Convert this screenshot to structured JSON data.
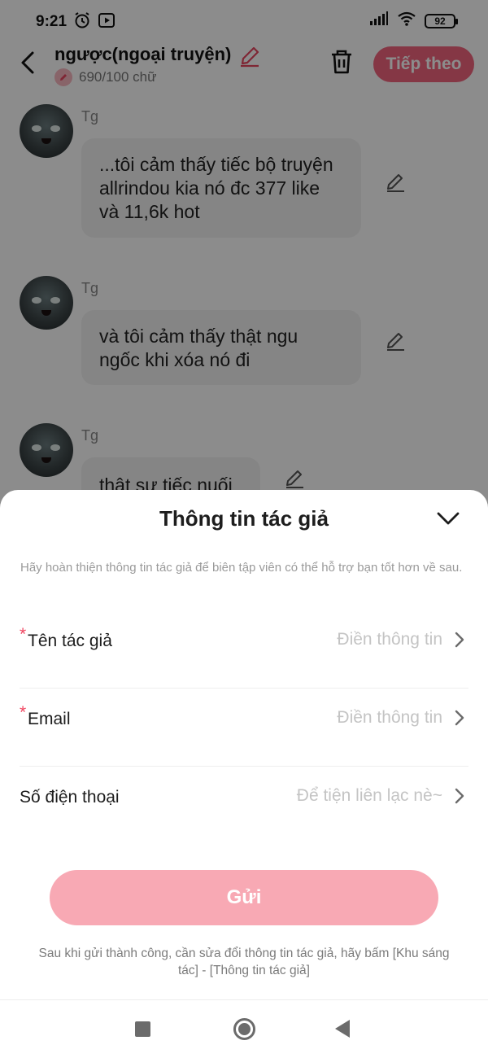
{
  "status_bar": {
    "time": "9:21",
    "battery": "92"
  },
  "header": {
    "title": "ngược(ngoại truyện)",
    "word_count": "690/100 chữ",
    "next_label": "Tiếp theo"
  },
  "messages": [
    {
      "sender": "Tg",
      "text": "...tôi cảm thấy tiếc bộ truyện allrindou kia nó đc 377 like và 11,6k hot"
    },
    {
      "sender": "Tg",
      "text": "và tôi cảm thấy thật ngu ngốc khi xóa nó đi"
    },
    {
      "sender": "Tg",
      "text": "thật sự tiếc nuối"
    }
  ],
  "sheet": {
    "title": "Thông tin tác giả",
    "description": "Hãy hoàn thiện thông tin tác giả để biên tập viên có thể hỗ trợ bạn tốt hơn về sau.",
    "fields": [
      {
        "required_mark": "*",
        "label": "Tên tác giả",
        "value": "Điền thông tin"
      },
      {
        "required_mark": "*",
        "label": "Email",
        "value": "Điền thông tin"
      },
      {
        "label": "Số điện thoại",
        "value": "Để tiện liên lạc nè~"
      }
    ],
    "submit_label": "Gửi",
    "footer": "Sau khi gửi thành công, cần sửa đổi thông tin tác giả, hãy bấm [Khu sáng tác] - [Thông tin tác giả]"
  },
  "colors": {
    "accent": "#f2647e",
    "submit_disabled": "#f8a9b4",
    "required": "#f0445f"
  }
}
